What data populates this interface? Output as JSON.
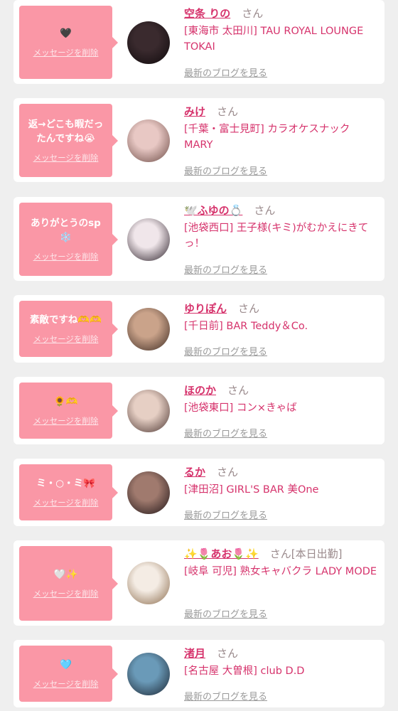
{
  "items": [
    {
      "message": "🖤",
      "delete_label": "メッセージを削除",
      "name": "空条 りの",
      "honorific": "さん",
      "extra": "",
      "shop": "[東海市 太田川] TAU ROYAL LOUNGE TOKAI",
      "blog_label": "最新のブログを見る",
      "avatar_colors": [
        "#3a2a2e",
        "#0f0a0c"
      ]
    },
    {
      "message": "返→どこも暇だったんですね😭",
      "delete_label": "メッセージを削除",
      "name": "みけ",
      "honorific": "さん",
      "extra": "",
      "shop": "[千葉・富士見町] カラオケスナック MARY",
      "blog_label": "最新のブログを見る",
      "avatar_colors": [
        "#e8c8c4",
        "#6b4a44"
      ]
    },
    {
      "message": "ありがとうのsp❄️",
      "delete_label": "メッセージを削除",
      "name": "🕊️ふゆの💍",
      "honorific": "さん",
      "extra": "",
      "shop": "[池袋西口] 王子様(キミ)がむかえにきてっ！",
      "blog_label": "最新のブログを見る",
      "avatar_colors": [
        "#f0e6ea",
        "#2a1f28"
      ]
    },
    {
      "message": "素敵ですね🫶🫶",
      "delete_label": "メッセージを削除",
      "name": "ゆりぽん",
      "honorific": "さん",
      "extra": "",
      "shop": "[千日前] BAR Teddy＆Co.",
      "blog_label": "最新のブログを見る",
      "avatar_colors": [
        "#caa38a",
        "#3c2a22"
      ]
    },
    {
      "message": "🌻🫶",
      "delete_label": "メッセージを削除",
      "name": "ほのか",
      "honorific": "さん",
      "extra": "",
      "shop": "[池袋東口] コン×きゃば",
      "blog_label": "最新のブログを見る",
      "avatar_colors": [
        "#e6cfc4",
        "#4a3430"
      ]
    },
    {
      "message": "ミ・○・ミ🎀",
      "delete_label": "メッセージを削除",
      "name": "るか",
      "honorific": "さん",
      "extra": "",
      "shop": "[津田沼] GIRL'S BAR 美One",
      "blog_label": "最新のブログを見る",
      "avatar_colors": [
        "#a07a6e",
        "#1e1416"
      ]
    },
    {
      "message": "🤍✨",
      "delete_label": "メッセージを削除",
      "name": "✨🌷あお🌷✨",
      "honorific": "さん",
      "extra": "[本日出勤]",
      "shop": "[岐阜 可児] 熟女キャバクラ LADY MODE",
      "blog_label": "最新のブログを見る",
      "avatar_colors": [
        "#f4ece4",
        "#8a6a4a"
      ]
    },
    {
      "message": "🩵",
      "delete_label": "メッセージを削除",
      "name": "渚月",
      "honorific": "さん",
      "extra": "",
      "shop": "[名古屋 大曽根] club D.D",
      "blog_label": "最新のブログを見る",
      "avatar_colors": [
        "#6a9ab8",
        "#1a2430"
      ]
    }
  ]
}
